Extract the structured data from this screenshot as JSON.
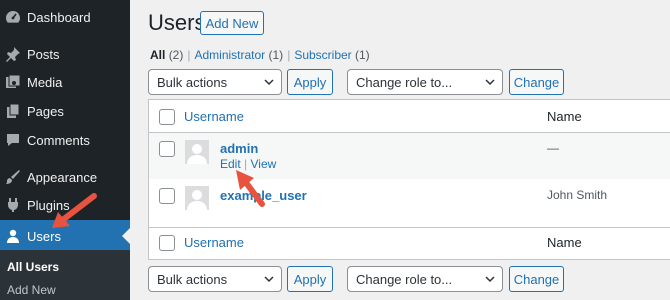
{
  "sidebar": {
    "items": [
      {
        "label": "Dashboard",
        "icon": "dashboard-icon"
      },
      {
        "label": "Posts",
        "icon": "pin-icon"
      },
      {
        "label": "Media",
        "icon": "media-icon"
      },
      {
        "label": "Pages",
        "icon": "pages-icon"
      },
      {
        "label": "Comments",
        "icon": "comment-icon"
      },
      {
        "label": "Appearance",
        "icon": "paintbrush-icon"
      },
      {
        "label": "Plugins",
        "icon": "plugin-icon"
      },
      {
        "label": "Users",
        "icon": "users-icon"
      }
    ],
    "submenu": [
      "All Users",
      "Add New"
    ]
  },
  "header": {
    "title": "Users",
    "add_new": "Add New"
  },
  "filters": [
    {
      "label": "All",
      "count": "(2)"
    },
    {
      "label": "Administrator",
      "count": "(1)"
    },
    {
      "label": "Subscriber",
      "count": "(1)"
    }
  ],
  "bulk": {
    "select": "Bulk actions",
    "apply": "Apply",
    "role": "Change role to...",
    "change": "Change"
  },
  "table": {
    "columns": [
      "Username",
      "Name"
    ],
    "rows": [
      {
        "username": "admin",
        "name": "—",
        "actions": [
          "Edit",
          "View"
        ]
      },
      {
        "username": "example_user",
        "name": "John Smith"
      }
    ]
  },
  "colors": {
    "accent": "#2271b1",
    "sidebar": "#1d2327",
    "annotation": "#e8533f"
  }
}
